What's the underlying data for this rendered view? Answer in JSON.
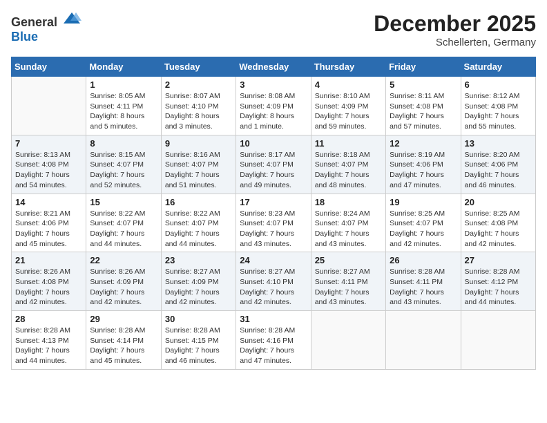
{
  "logo": {
    "general": "General",
    "blue": "Blue"
  },
  "title": {
    "month_year": "December 2025",
    "location": "Schellerten, Germany"
  },
  "headers": [
    "Sunday",
    "Monday",
    "Tuesday",
    "Wednesday",
    "Thursday",
    "Friday",
    "Saturday"
  ],
  "weeks": [
    [
      {
        "day": "",
        "info": ""
      },
      {
        "day": "1",
        "info": "Sunrise: 8:05 AM\nSunset: 4:11 PM\nDaylight: 8 hours\nand 5 minutes."
      },
      {
        "day": "2",
        "info": "Sunrise: 8:07 AM\nSunset: 4:10 PM\nDaylight: 8 hours\nand 3 minutes."
      },
      {
        "day": "3",
        "info": "Sunrise: 8:08 AM\nSunset: 4:09 PM\nDaylight: 8 hours\nand 1 minute."
      },
      {
        "day": "4",
        "info": "Sunrise: 8:10 AM\nSunset: 4:09 PM\nDaylight: 7 hours\nand 59 minutes."
      },
      {
        "day": "5",
        "info": "Sunrise: 8:11 AM\nSunset: 4:08 PM\nDaylight: 7 hours\nand 57 minutes."
      },
      {
        "day": "6",
        "info": "Sunrise: 8:12 AM\nSunset: 4:08 PM\nDaylight: 7 hours\nand 55 minutes."
      }
    ],
    [
      {
        "day": "7",
        "info": "Sunrise: 8:13 AM\nSunset: 4:08 PM\nDaylight: 7 hours\nand 54 minutes."
      },
      {
        "day": "8",
        "info": "Sunrise: 8:15 AM\nSunset: 4:07 PM\nDaylight: 7 hours\nand 52 minutes."
      },
      {
        "day": "9",
        "info": "Sunrise: 8:16 AM\nSunset: 4:07 PM\nDaylight: 7 hours\nand 51 minutes."
      },
      {
        "day": "10",
        "info": "Sunrise: 8:17 AM\nSunset: 4:07 PM\nDaylight: 7 hours\nand 49 minutes."
      },
      {
        "day": "11",
        "info": "Sunrise: 8:18 AM\nSunset: 4:07 PM\nDaylight: 7 hours\nand 48 minutes."
      },
      {
        "day": "12",
        "info": "Sunrise: 8:19 AM\nSunset: 4:06 PM\nDaylight: 7 hours\nand 47 minutes."
      },
      {
        "day": "13",
        "info": "Sunrise: 8:20 AM\nSunset: 4:06 PM\nDaylight: 7 hours\nand 46 minutes."
      }
    ],
    [
      {
        "day": "14",
        "info": "Sunrise: 8:21 AM\nSunset: 4:06 PM\nDaylight: 7 hours\nand 45 minutes."
      },
      {
        "day": "15",
        "info": "Sunrise: 8:22 AM\nSunset: 4:07 PM\nDaylight: 7 hours\nand 44 minutes."
      },
      {
        "day": "16",
        "info": "Sunrise: 8:22 AM\nSunset: 4:07 PM\nDaylight: 7 hours\nand 44 minutes."
      },
      {
        "day": "17",
        "info": "Sunrise: 8:23 AM\nSunset: 4:07 PM\nDaylight: 7 hours\nand 43 minutes."
      },
      {
        "day": "18",
        "info": "Sunrise: 8:24 AM\nSunset: 4:07 PM\nDaylight: 7 hours\nand 43 minutes."
      },
      {
        "day": "19",
        "info": "Sunrise: 8:25 AM\nSunset: 4:07 PM\nDaylight: 7 hours\nand 42 minutes."
      },
      {
        "day": "20",
        "info": "Sunrise: 8:25 AM\nSunset: 4:08 PM\nDaylight: 7 hours\nand 42 minutes."
      }
    ],
    [
      {
        "day": "21",
        "info": "Sunrise: 8:26 AM\nSunset: 4:08 PM\nDaylight: 7 hours\nand 42 minutes."
      },
      {
        "day": "22",
        "info": "Sunrise: 8:26 AM\nSunset: 4:09 PM\nDaylight: 7 hours\nand 42 minutes."
      },
      {
        "day": "23",
        "info": "Sunrise: 8:27 AM\nSunset: 4:09 PM\nDaylight: 7 hours\nand 42 minutes."
      },
      {
        "day": "24",
        "info": "Sunrise: 8:27 AM\nSunset: 4:10 PM\nDaylight: 7 hours\nand 42 minutes."
      },
      {
        "day": "25",
        "info": "Sunrise: 8:27 AM\nSunset: 4:11 PM\nDaylight: 7 hours\nand 43 minutes."
      },
      {
        "day": "26",
        "info": "Sunrise: 8:28 AM\nSunset: 4:11 PM\nDaylight: 7 hours\nand 43 minutes."
      },
      {
        "day": "27",
        "info": "Sunrise: 8:28 AM\nSunset: 4:12 PM\nDaylight: 7 hours\nand 44 minutes."
      }
    ],
    [
      {
        "day": "28",
        "info": "Sunrise: 8:28 AM\nSunset: 4:13 PM\nDaylight: 7 hours\nand 44 minutes."
      },
      {
        "day": "29",
        "info": "Sunrise: 8:28 AM\nSunset: 4:14 PM\nDaylight: 7 hours\nand 45 minutes."
      },
      {
        "day": "30",
        "info": "Sunrise: 8:28 AM\nSunset: 4:15 PM\nDaylight: 7 hours\nand 46 minutes."
      },
      {
        "day": "31",
        "info": "Sunrise: 8:28 AM\nSunset: 4:16 PM\nDaylight: 7 hours\nand 47 minutes."
      },
      {
        "day": "",
        "info": ""
      },
      {
        "day": "",
        "info": ""
      },
      {
        "day": "",
        "info": ""
      }
    ]
  ]
}
